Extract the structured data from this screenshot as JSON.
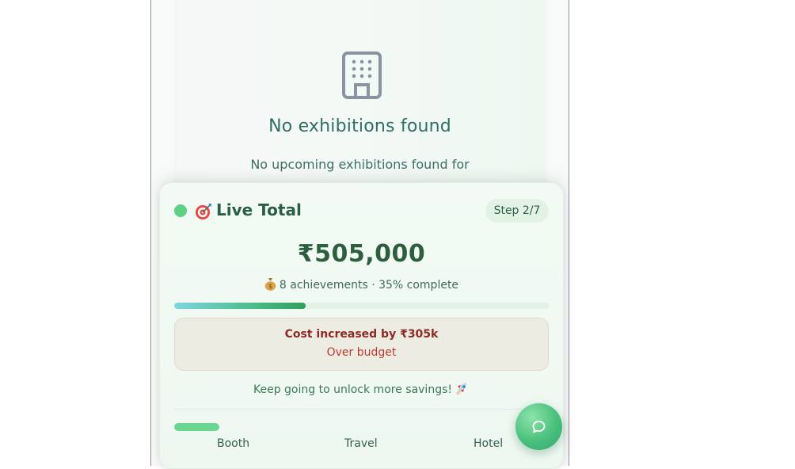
{
  "empty_state": {
    "icon": "building-icon",
    "title": "No exhibitions found",
    "description": "No upcoming exhibitions found for"
  },
  "live_total": {
    "status_color": "#5fd184",
    "emoji_icon": "target-icon",
    "title": "Live Total",
    "step_badge": "Step 2/7",
    "amount": "₹505,000",
    "achievements_text": "8 achievements · 35% complete",
    "progress_percent": 35,
    "cost_warning": {
      "title": "Cost increased by ₹305k",
      "subtitle": "Over budget"
    },
    "encouragement": "Keep going to unlock more savings!",
    "tabs": [
      {
        "label": "Booth",
        "active": true
      },
      {
        "label": "Travel",
        "active": false
      },
      {
        "label": "Hotel",
        "active": false
      }
    ]
  },
  "chat_button": {
    "icon": "chat-bubble-icon"
  },
  "colors": {
    "accent_green": "#5fd184",
    "primary_text": "#2a5e47",
    "warning_red": "#c0392b"
  }
}
